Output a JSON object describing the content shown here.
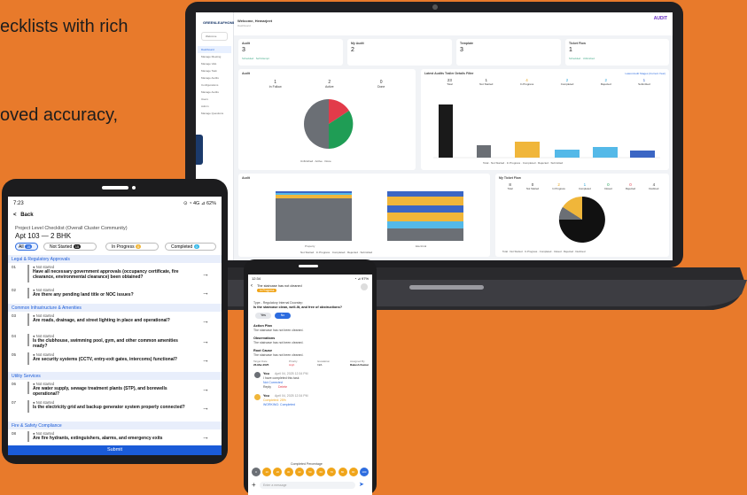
{
  "hero": {
    "line1": "ecklists with rich",
    "line2": "oved accuracy,"
  },
  "laptop": {
    "sidebar": {
      "logo": "GREENLEAFHOME",
      "user": "Welcome",
      "items": [
        "Dashboard",
        "Manage Meeting",
        "Manage Vals",
        "Manage Task",
        "Manage Audits",
        "Configurations",
        "Manage Audits",
        "Users",
        "Admin",
        "Manage Questions"
      ]
    },
    "header": {
      "title": "Welcome, Hemarjeet",
      "subtitle": "Dashboard",
      "brand": "AUDIT"
    },
    "kpis": [
      {
        "label": "Audit",
        "value": "3",
        "foot": "Scheduled · Self Attempt"
      },
      {
        "label": "My Audit",
        "value": "2",
        "foot": ""
      },
      {
        "label": "Template",
        "value": "3",
        "foot": ""
      },
      {
        "label": "Ticket Flow",
        "value": "1",
        "foot": "Scheduled · Unfinished"
      }
    ],
    "panel1": {
      "title": "Audit",
      "stats": [
        {
          "n": "1",
          "l": "In Follow"
        },
        {
          "n": "2",
          "l": "Active"
        },
        {
          "n": "0",
          "l": "Done"
        }
      ],
      "legend": "Unfinished · Active · Done"
    },
    "panel2": {
      "title": "Latest Audits Trailer Details Filter",
      "link": "Latest Audit Stages (Current Year)",
      "stats": [
        {
          "n": "23",
          "l": "Total"
        },
        {
          "n": "1",
          "l": "Not Started"
        },
        {
          "n": "4",
          "l": "In Progress"
        },
        {
          "n": "2",
          "l": "Completed"
        },
        {
          "n": "2",
          "l": "Rejected"
        },
        {
          "n": "1",
          "l": "Submitted"
        }
      ],
      "legend": "Total · Not Started · In Progress · Completed · Rejected · Submitted"
    },
    "panel3": {
      "title": "Audit",
      "xlabels": [
        "Property",
        "Electrical"
      ],
      "legend": "Not Started · In Progress · Completed · Rejected · Submitted"
    },
    "panel4": {
      "title": "My Ticket Flow",
      "stats": [
        {
          "n": "8",
          "l": "Total"
        },
        {
          "n": "0",
          "l": "Not Started"
        },
        {
          "n": "2",
          "l": "In Progress"
        },
        {
          "n": "1",
          "l": "Completed"
        },
        {
          "n": "0",
          "l": "Closed"
        },
        {
          "n": "0",
          "l": "Rejected"
        },
        {
          "n": "4",
          "l": "Declined"
        }
      ],
      "legend": "Total · Not Started · In Progress · Completed · Closed · Rejected · Declined"
    }
  },
  "tablet": {
    "status_time": "7:23",
    "status_right": "⊙ ◔ 4G ⊿ 62%",
    "back": "Back",
    "title": "Project Level Checklist (Overall Cluster Community)",
    "apt": "Apt 103 — 2 BHK",
    "filters": [
      {
        "label": "All",
        "count": "15"
      },
      {
        "label": "Not Started",
        "count": "15"
      },
      {
        "label": "In Progress",
        "count": "0"
      },
      {
        "label": "Completed",
        "count": "0"
      }
    ],
    "sections": [
      "Legal & Regulatory Approvals",
      "Common Infrastructure & Amenities",
      "Utility Services",
      "Fire & Safety Compliance"
    ],
    "not_started": "Not started",
    "rows": [
      {
        "n": "01",
        "q": "Have all necessary government approvals (occupancy certificate, fire clearance, environmental clearance) been obtained?"
      },
      {
        "n": "02",
        "q": "Are there any pending land title or NOC issues?"
      },
      {
        "n": "03",
        "q": "Are roads, drainage, and street lighting in place and operational?"
      },
      {
        "n": "04",
        "q": "Is the clubhouse, swimming pool, gym, and other common amenities ready?"
      },
      {
        "n": "05",
        "q": "Are security systems (CCTV, entry-exit gates, intercoms) functional?"
      },
      {
        "n": "06",
        "q": "Are water supply, sewage treatment plants (STP), and borewells operational?"
      },
      {
        "n": "07",
        "q": "Is the electricity grid and backup generator system properly connected?"
      },
      {
        "n": "08",
        "q": "Are fire hydrants, extinguishers, alarms, and emergency exits"
      }
    ],
    "submit": "Submit"
  },
  "phone": {
    "status_time": "12:34",
    "status_right": "◔ ⊿ 97%",
    "header_text": "The staircase has not cleaned",
    "header_badge": "In Progress",
    "type_line": "Type - Regulatory Internal Doorstep",
    "question": "Is the staircase clean, well-lit, and free of obstructions?",
    "yes": "Yes",
    "no": "No",
    "action_plan_label": "Action Plan",
    "action_plan": "The staircase has not been cleaned.",
    "obs_label": "Observations",
    "obs": "The staircase has not been cleaned.",
    "root_label": "Root Cause",
    "root": "The staircase has not been cleaned.",
    "meta": [
      {
        "k": "Target Date",
        "v": "26-Mar-2025"
      },
      {
        "k": "Priority",
        "v": "High"
      },
      {
        "k": "Escalation",
        "v": "N/A"
      },
      {
        "k": "Assigned By",
        "v": "Rakesh Kumar"
      }
    ],
    "comments": [
      {
        "a": "You",
        "t": "April 04, 2025 12:34 PM",
        "b": "I have completed this task",
        "s": "Not Corrected",
        "r": "Reply",
        "d": "Delete"
      },
      {
        "a": "You",
        "t": "April 04, 2025 12:34 PM",
        "b": "Completed: 25%",
        "s": "WORKING: Completed"
      }
    ],
    "progress_label": "Completed Percentage",
    "steps": [
      "0",
      "10",
      "20",
      "30",
      "40",
      "50",
      "60",
      "70",
      "80",
      "90",
      "100"
    ],
    "input_placeholder": "Enter a message"
  }
}
